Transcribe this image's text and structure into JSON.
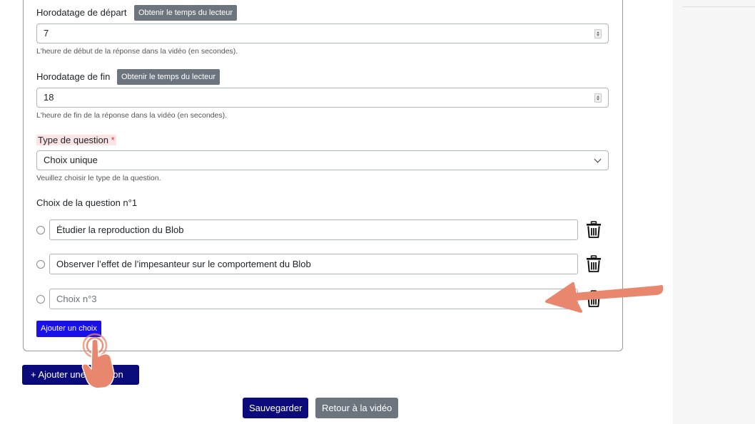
{
  "form": {
    "start": {
      "label": "Horodatage de départ",
      "button": "Obtenir le temps du lecteur",
      "value": "7",
      "help": "L'heure de début de la réponse dans la vidéo (en secondes)."
    },
    "end": {
      "label": "Horodatage de fin",
      "button": "Obtenir le temps du lecteur",
      "value": "18",
      "help": "L'heure de fin de la réponse dans la vidéo (en secondes)."
    },
    "question_type": {
      "label": "Type de question",
      "required_mark": "*",
      "selected": "Choix unique",
      "help": "Veuillez choisir le type de la question."
    },
    "choices": {
      "heading": "Choix de la question n°1",
      "items": [
        {
          "value": "Étudier la reproduction du Blob",
          "placeholder": ""
        },
        {
          "value": "Observer l’effet de l’impesanteur sur le comportement du Blob",
          "placeholder": ""
        },
        {
          "value": "",
          "placeholder": "Choix n°3"
        }
      ],
      "add_label": "Ajouter un choix"
    }
  },
  "actions": {
    "add_question": "+  Ajouter une question",
    "save": "Sauvegarder",
    "back": "Retour à la vidéo"
  },
  "colors": {
    "primary_dark": "#0a0a7a",
    "primary_bright": "#1a10e8",
    "secondary": "#6c757d",
    "annotation": "#e8876e"
  },
  "icons": {
    "delete": "trash-icon",
    "annotation_arrow": "arrow-annotation-icon",
    "annotation_pointer": "tap-hand-icon"
  }
}
